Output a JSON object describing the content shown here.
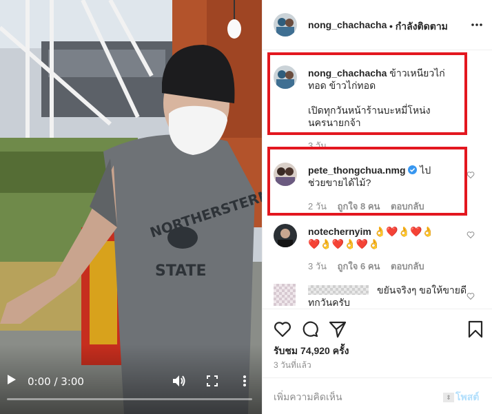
{
  "video": {
    "time_display": "0:00 / 3:00",
    "progress_fraction": 0.0
  },
  "header": {
    "username": "nong_chachacha",
    "follow_status": "• กำลังติดตาม"
  },
  "comments": [
    {
      "username": "nong_chachacha",
      "lines": [
        "ข้าวเหนียวไก่",
        "ทอด ข้าวไก่ทอด",
        "",
        "เปิดทุกวันหน้าร้านบะหมี่โหน่ง",
        "นครนายกจ้า"
      ],
      "time": "3 วัน"
    },
    {
      "username": "pete_thongchua.nmg",
      "verified": true,
      "lines": [
        "ไป",
        "ช่วยขายได้ไม้?"
      ],
      "time": "2 วัน",
      "likes": "ถูกใจ 8 คน",
      "reply": "ตอบกลับ"
    },
    {
      "username": "notechernyim",
      "lines": [
        "👌❤️👌❤️👌",
        "❤️👌❤️👌❤️👌"
      ],
      "time": "3 วัน",
      "likes": "ถูกใจ 6 คน",
      "reply": "ตอบกลับ"
    },
    {
      "username": "",
      "lines": [
        "ขยันจริงๆ ขอให้ขายดี",
        "ทกวันครับ"
      ]
    }
  ],
  "stats": {
    "views": "รับชม 74,920 ครั้ง",
    "posted": "3 วันที่แล้ว"
  },
  "add_comment": {
    "placeholder": "เพิ่มความคิดเห็น",
    "post_label": "โพสต์"
  },
  "colors": {
    "highlight": "#e3171f",
    "verified": "#3897f0",
    "heart_red": "#e0245e"
  }
}
